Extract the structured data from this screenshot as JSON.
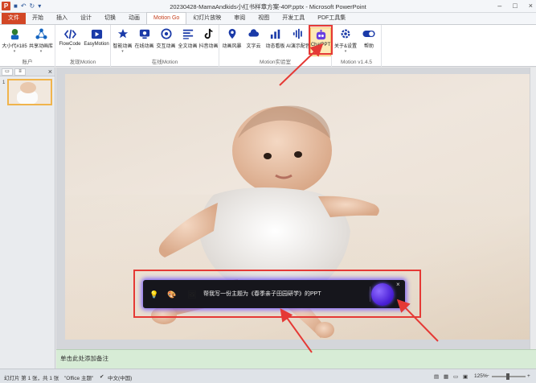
{
  "window": {
    "title": "20230428-MamaAndkids小红书样章方案-40P.pptx - Microsoft PowerPoint",
    "logo_letter": "P"
  },
  "tabs": [
    "文件",
    "开始",
    "插入",
    "设计",
    "切换",
    "动画",
    "Motion Go",
    "幻灯片放映",
    "审阅",
    "视图",
    "开发工具",
    "PDF工具集"
  ],
  "ribbon": {
    "groups": [
      {
        "label": "账户",
        "buttons": [
          "大小代#185",
          "共享动画库"
        ]
      },
      {
        "label": "发现Motion",
        "buttons": [
          "FlowCode",
          "EasyMotion"
        ]
      },
      {
        "label": "在线Motion",
        "buttons": [
          "智能动画",
          "在线动画",
          "交互动画",
          "全文动画",
          "抖音动画"
        ]
      },
      {
        "label": "Motion实验室",
        "buttons": [
          "动画风暴",
          "文字云",
          "动态看板",
          "AI演示配音",
          "ChatPPT"
        ]
      },
      {
        "label": "Motion v1.4.5",
        "buttons": [
          "关于&设置",
          "帮助"
        ]
      }
    ]
  },
  "left_panel": {
    "slide_number": "1"
  },
  "notes": {
    "placeholder": "单击此处添加备注"
  },
  "status": {
    "slide_info": "幻灯片 第 1 张，共 1 张",
    "theme": "\"Office 主题\"",
    "language": "中文(中国)",
    "zoom": "125%"
  },
  "chat": {
    "prompt": "帮我写一份主题为《春季亲子田园研学》的PPT",
    "close_glyph": "×"
  }
}
